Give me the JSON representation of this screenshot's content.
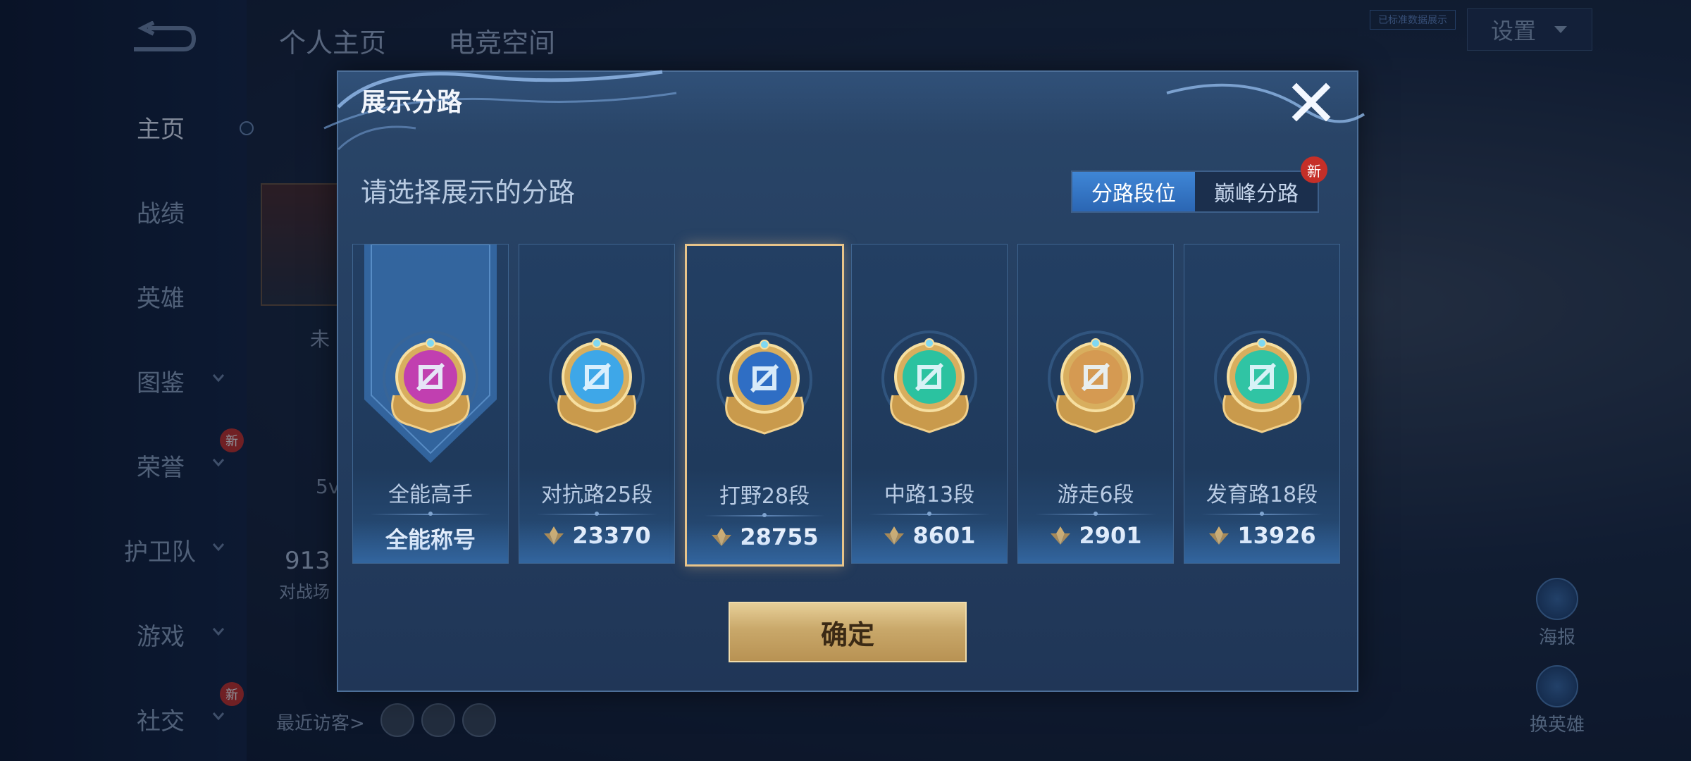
{
  "background": {
    "top_tabs": [
      "个人主页",
      "电竞空间"
    ],
    "settings_label": "设置",
    "small_tag": "已标准数据展示",
    "nav": [
      {
        "label": "主页",
        "active": true
      },
      {
        "label": "战绩"
      },
      {
        "label": "英雄"
      },
      {
        "label": "图鉴",
        "chevron": true
      },
      {
        "label": "荣誉",
        "chevron": true,
        "new": true
      },
      {
        "label": "护卫队",
        "chevron": true
      },
      {
        "label": "游戏",
        "chevron": true
      },
      {
        "label": "社交",
        "chevron": true,
        "new": true
      }
    ],
    "new_badge": "新",
    "fragments": {
      "unlabeled_1": "未",
      "mode": "5v",
      "number": "913",
      "stat_label": "对战场",
      "recent_visitors": "最近访客>"
    },
    "right_buttons": {
      "poster": "海报",
      "change_hero": "换英雄"
    }
  },
  "dialog": {
    "title": "展示分路",
    "prompt": "请选择展示的分路",
    "segments": [
      {
        "label": "分路段位",
        "active": true
      },
      {
        "label": "巅峰分路",
        "new": true
      }
    ],
    "new_badge": "新",
    "cards": [
      {
        "name": "全能高手",
        "value": "全能称号",
        "emblem": "all-round-emblem",
        "color": "#c13fb0",
        "selected": false,
        "banner": true
      },
      {
        "name": "对抗路25段",
        "value": "23370",
        "emblem": "clash-lane-emblem",
        "color": "#3ea7e8",
        "selected": false
      },
      {
        "name": "打野28段",
        "value": "28755",
        "emblem": "jungle-emblem",
        "color": "#2f6ec4",
        "selected": true
      },
      {
        "name": "中路13段",
        "value": "8601",
        "emblem": "mid-lane-emblem",
        "color": "#2bc2a0",
        "selected": false
      },
      {
        "name": "游走6段",
        "value": "2901",
        "emblem": "roam-emblem",
        "color": "#d59a52",
        "selected": false
      },
      {
        "name": "发育路18段",
        "value": "13926",
        "emblem": "farm-lane-emblem",
        "color": "#30c4a4",
        "selected": false
      }
    ],
    "confirm_label": "确定"
  }
}
